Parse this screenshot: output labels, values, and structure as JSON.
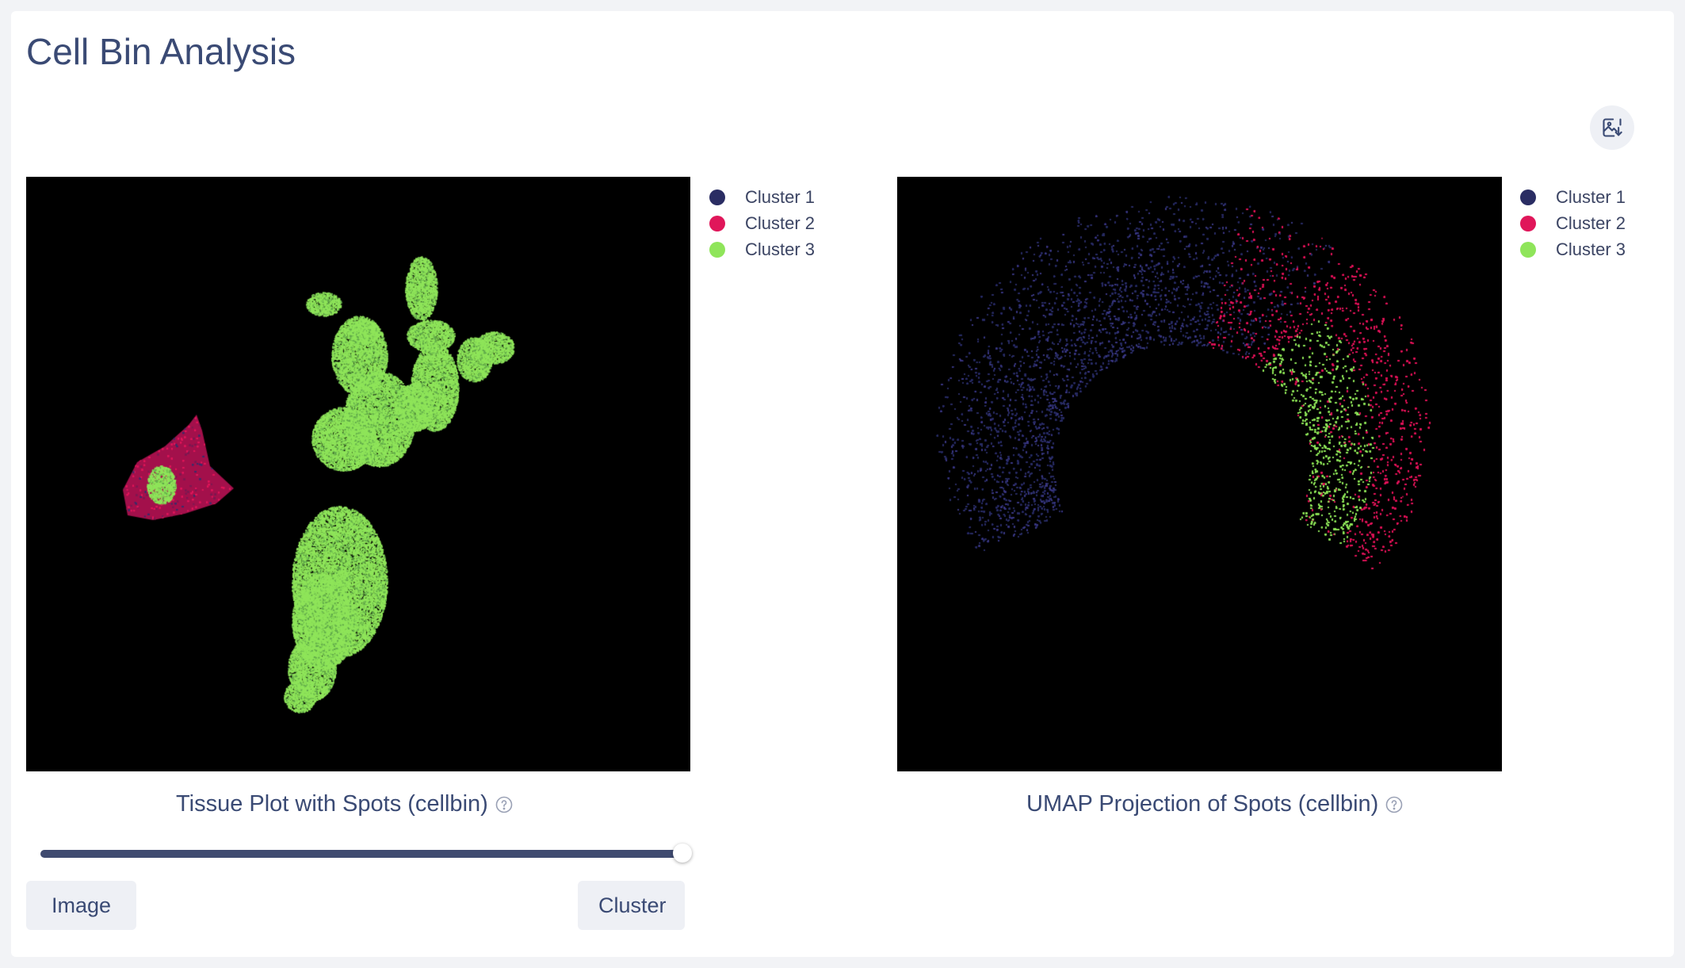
{
  "page": {
    "title": "Cell Bin Analysis"
  },
  "toolbar": {
    "export_icon": "image-download-icon"
  },
  "colors": {
    "cluster_1": "#2a2d63",
    "cluster_2": "#e0165a",
    "cluster_3": "#8fe55a",
    "accent": "#3f4a70"
  },
  "tissue_plot": {
    "caption": "Tissue Plot with Spots (cellbin)",
    "legend": [
      {
        "label": "Cluster 1",
        "color": "#2a2d63"
      },
      {
        "label": "Cluster 2",
        "color": "#e0165a"
      },
      {
        "label": "Cluster 3",
        "color": "#8fe55a"
      }
    ]
  },
  "umap_plot": {
    "caption": "UMAP Projection of Spots (cellbin)",
    "legend": [
      {
        "label": "Cluster 1",
        "color": "#2a2d63"
      },
      {
        "label": "Cluster 2",
        "color": "#e0165a"
      },
      {
        "label": "Cluster 3",
        "color": "#8fe55a"
      }
    ]
  },
  "blend_slider": {
    "value": 1.0,
    "min": 0,
    "max": 1
  },
  "buttons": {
    "image_label": "Image",
    "cluster_label": "Cluster"
  }
}
